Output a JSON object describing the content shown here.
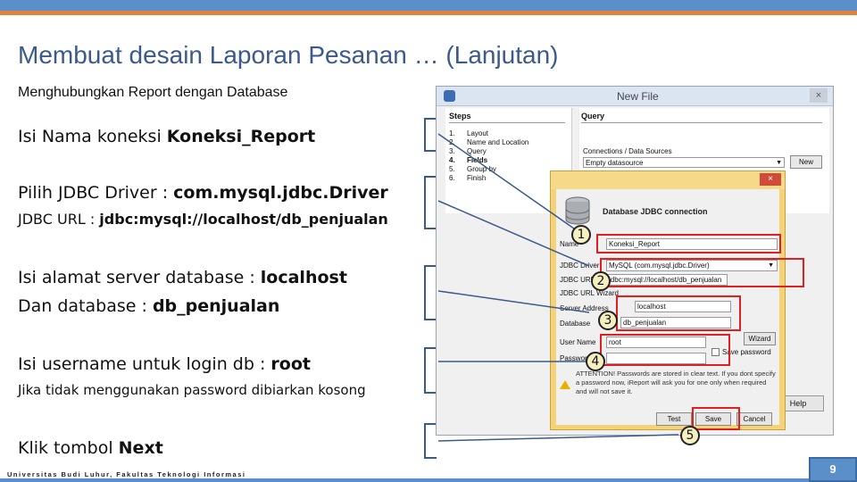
{
  "slide": {
    "title": "Membuat desain Laporan Pesanan … (Lanjutan)",
    "subtitle": "Menghubungkan Report dengan Database",
    "footer": "Universitas Budi Luhur, Fakultas Teknologi Informasi",
    "page_number": "9"
  },
  "instructions": [
    {
      "prefix": "Isi Nama koneksi ",
      "value": "Koneksi_Report"
    },
    {
      "prefix": "Pilih JDBC Driver : ",
      "value": "com.mysql.jdbc.Driver"
    },
    {
      "prefix": "JDBC URL : ",
      "value": "jdbc:mysql://localhost/db_penjualan"
    },
    {
      "prefix": "Isi alamat server database : ",
      "value": "localhost"
    },
    {
      "prefix": "Dan database : ",
      "value": "db_penjualan"
    },
    {
      "prefix": "Isi username untuk login db : ",
      "value": "root"
    },
    {
      "prefix": "Jika tidak menggunakan password dibiarkan kosong",
      "value": ""
    },
    {
      "prefix": "Klik tombol ",
      "value": "Next"
    }
  ],
  "new_file_dialog": {
    "title": "New File",
    "close": "×",
    "steps_header": "Steps",
    "steps": [
      {
        "n": "1.",
        "label": "Layout"
      },
      {
        "n": "2.",
        "label": "Name and Location"
      },
      {
        "n": "3.",
        "label": "Query"
      },
      {
        "n": "4.",
        "label": "Fields"
      },
      {
        "n": "5.",
        "label": "Group by"
      },
      {
        "n": "6.",
        "label": "Finish"
      }
    ],
    "query_header": "Query",
    "connections_label": "Connections / Data Sources",
    "connections_value": "Empty datasource",
    "new_button": "New",
    "help_button": "Help"
  },
  "jdbc_dialog": {
    "close": "×",
    "heading": "Database JDBC connection",
    "name_label": "Name",
    "name_value": "Koneksi_Report",
    "driver_label": "JDBC Driver",
    "driver_value": "MySQL (com.mysql.jdbc.Driver)",
    "url_label": "JDBC URL",
    "url_value": "jdbc:mysql://localhost/db_penjualan",
    "url_wizard_label": "JDBC URL Wizard",
    "server_label": "Server Address",
    "server_value": "localhost",
    "database_label": "Database",
    "database_value": "db_penjualan",
    "wizard_button": "Wizard",
    "username_label": "User Name",
    "username_value": "root",
    "password_label": "Password",
    "save_password_label": "Save password",
    "warning_text": "ATTENTION! Passwords are stored in clear text. If you dont specify a password now, iReport will ask you for one only when required and will not save it.",
    "test_button": "Test",
    "save_button": "Save",
    "cancel_button": "Cancel"
  },
  "badges": [
    "1",
    "2",
    "3",
    "4",
    "5"
  ],
  "colors": {
    "title": "#3b5a8a",
    "accent_blue": "#5b8fc9",
    "accent_orange": "#e0823d",
    "highlight_red": "#e02020",
    "dialog_yellow": "#f3d278"
  }
}
